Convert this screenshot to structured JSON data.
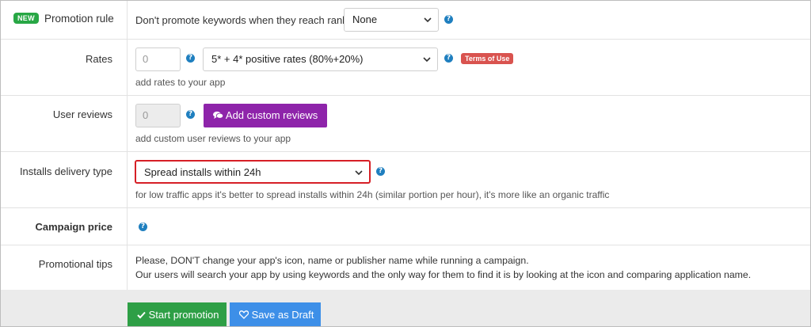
{
  "promotion_rule": {
    "badge": "NEW",
    "label": "Promotion rule",
    "description": "Don't promote keywords when they reach rank:",
    "select_value": "None"
  },
  "rates": {
    "label": "Rates",
    "input_value": "0",
    "select_value": "5* + 4* positive rates (80%+20%)",
    "terms_badge": "Terms of Use",
    "hint": "add rates to your app"
  },
  "user_reviews": {
    "label": "User reviews",
    "input_value": "0",
    "button_label": "Add custom reviews",
    "hint": "add custom user reviews to your app"
  },
  "installs_delivery": {
    "label": "Installs delivery type",
    "select_value": "Spread installs within 24h",
    "hint": "for low traffic apps it's better to spread installs within 24h (similar portion per hour), it's more like an organic traffic"
  },
  "campaign_price": {
    "label": "Campaign price"
  },
  "promotional_tips": {
    "label": "Promotional tips",
    "line1": "Please, DON'T change your app's icon, name or publisher name while running a campaign.",
    "line2": "Our users will search your app by using keywords and the only way for them to find it is by looking at the icon and comparing application name."
  },
  "footer": {
    "start_label": "Start promotion",
    "draft_label": "Save as Draft"
  },
  "colors": {
    "highlight": "#d61f26",
    "new_badge": "#28a745",
    "terms_badge": "#d9534f",
    "purple_button": "#8e24aa",
    "green_button": "#2e9f46",
    "blue_button": "#3d8fe8",
    "help_icon": "#1f7fbf"
  },
  "icons": [
    "help-icon",
    "chevron-down-icon",
    "comments-icon",
    "check-icon",
    "heart-icon"
  ]
}
